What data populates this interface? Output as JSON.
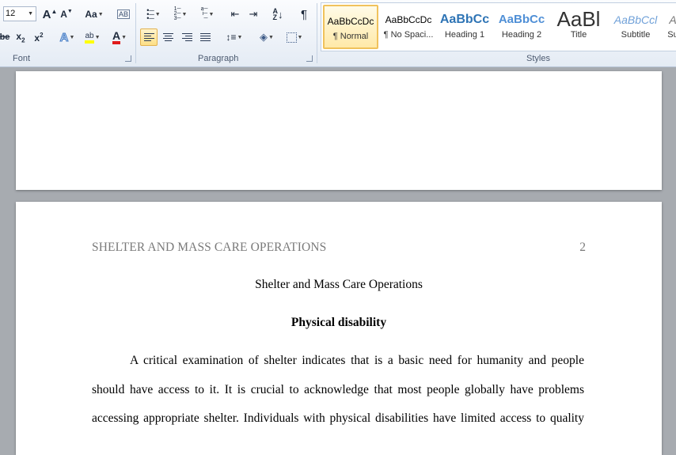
{
  "ribbon": {
    "font_size": "12",
    "groups": {
      "font": "Font",
      "paragraph": "Paragraph",
      "styles": "Styles"
    },
    "styles": [
      {
        "preview": "AaBbCcDc",
        "name": "¶ Normal"
      },
      {
        "preview": "AaBbCcDc",
        "name": "¶ No Spaci..."
      },
      {
        "preview": "AaBbCc",
        "name": "Heading 1"
      },
      {
        "preview": "AaBbCc",
        "name": "Heading 2"
      },
      {
        "preview": "AaBl",
        "name": "Title"
      },
      {
        "preview": "AaBbCcl",
        "name": "Subtitle"
      },
      {
        "preview": "A",
        "name": "Su"
      }
    ]
  },
  "document": {
    "running_head": "SHELTER AND MASS CARE OPERATIONS",
    "page_number": "2",
    "title": "Shelter and Mass Care Operations",
    "heading": "Physical disability",
    "lines": [
      "A critical examination of shelter indicates that is a basic need for humanity and people",
      "should have access to it. It is crucial to acknowledge that most people globally have problems",
      "accessing appropriate shelter. Individuals with physical disabilities have limited access to quality"
    ]
  },
  "colors": {
    "ribbon_bg": "#e4ebf4",
    "selected_style": "#ffe9a8",
    "heading_blue": "#2e74b5",
    "workspace": "#a7abb0"
  }
}
